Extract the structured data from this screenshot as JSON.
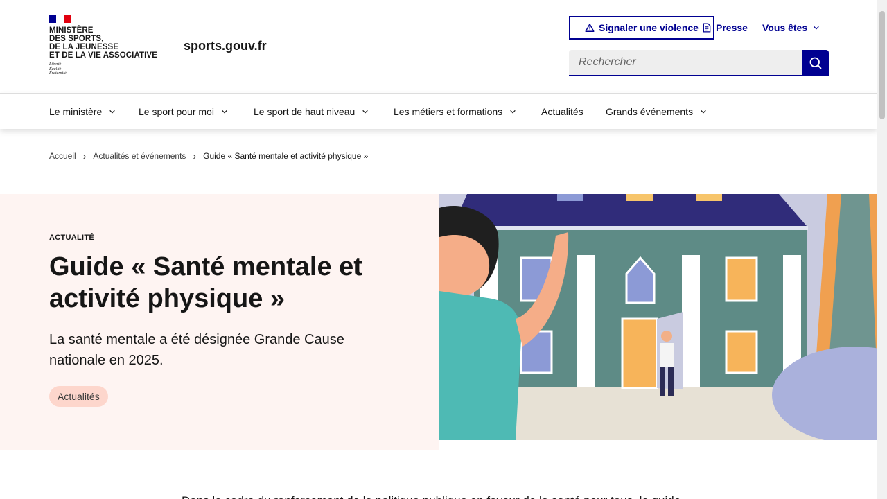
{
  "header": {
    "ministry_lines": [
      "MINISTÈRE",
      "DES SPORTS,",
      "DE LA JEUNESSE",
      "ET DE LA VIE ASSOCIATIVE"
    ],
    "devise": [
      "Liberté",
      "Égalité",
      "Fraternité"
    ],
    "site_name": "sports.gouv.fr",
    "report_violence_label": "Signaler une violence",
    "press_label": "Presse",
    "you_are_label": "Vous êtes",
    "search": {
      "placeholder": "Rechercher"
    }
  },
  "nav": {
    "items": [
      {
        "label": "Le ministère",
        "has_dropdown": true
      },
      {
        "label": "Le sport pour moi",
        "has_dropdown": true
      },
      {
        "label": "Le sport de haut niveau",
        "has_dropdown": true
      },
      {
        "label": "Les métiers et formations",
        "has_dropdown": true
      },
      {
        "label": "Actualités",
        "has_dropdown": false
      },
      {
        "label": "Grands événements",
        "has_dropdown": true
      }
    ]
  },
  "breadcrumb": {
    "items": [
      "Accueil",
      "Actualités et événements"
    ],
    "current": "Guide « Santé mentale et activité physique »"
  },
  "hero": {
    "kicker": "ACTUALITÉ",
    "title": "Guide « Santé mentale et activité physique »",
    "subtitle": "La santé mentale a été désignée Grande Cause nationale en 2025.",
    "tag": "Actualités"
  },
  "body": {
    "first_line": "Dans le cadre du renforcement de la politique publique en faveur de la santé pour tous, le guide"
  },
  "colors": {
    "primary": "#000091",
    "hero_bg": "#fef4f2",
    "tag_bg": "#fdd6cc"
  }
}
